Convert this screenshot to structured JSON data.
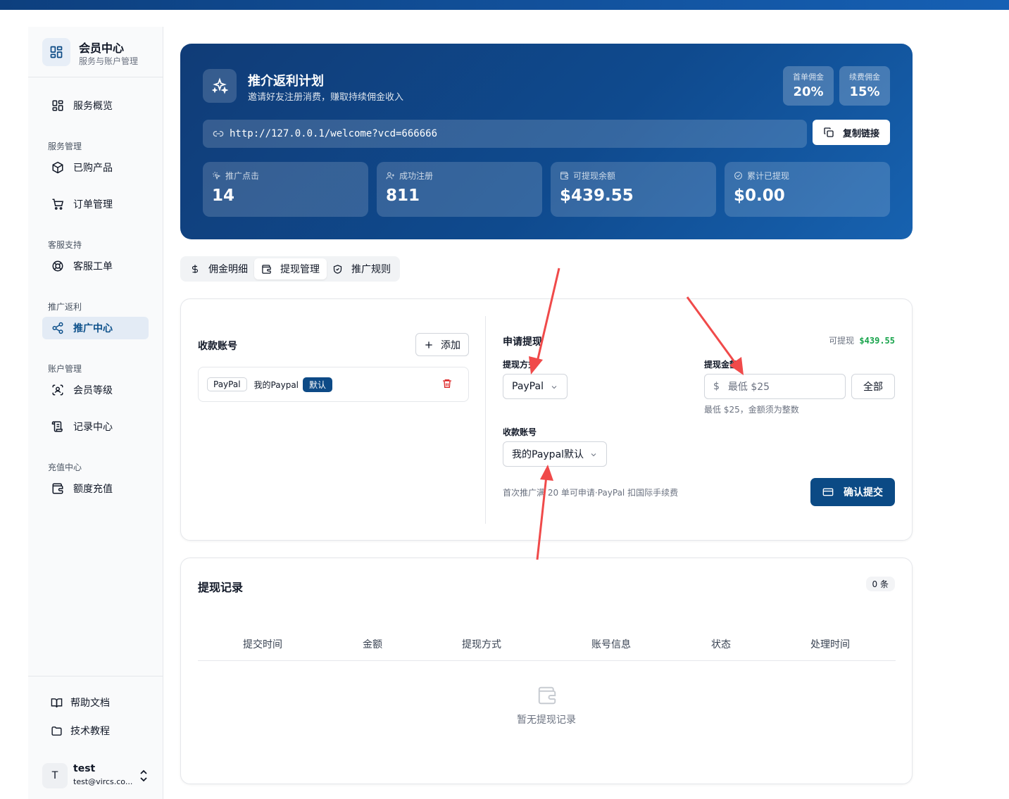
{
  "sidebar": {
    "brand_title": "会员中心",
    "brand_subtitle": "服务与账户管理",
    "overview": "服务概览",
    "groups": {
      "service": "服务管理",
      "support": "客服支持",
      "referral": "推广返利",
      "account": "账户管理",
      "recharge": "充值中心"
    },
    "items": {
      "purchased": "已购产品",
      "orders": "订单管理",
      "tickets": "客服工单",
      "referral_center": "推广中心",
      "member_level": "会员等级",
      "records": "记录中心",
      "quota_recharge": "额度充值"
    },
    "footer": {
      "help_docs": "帮助文档",
      "tutorials": "技术教程"
    },
    "user": {
      "avatar_letter": "T",
      "name": "test",
      "email": "test@vircs.co..."
    }
  },
  "hero": {
    "title": "推介返利计划",
    "subtitle": "邀请好友注册消费，赚取持续佣金收入",
    "first_commission_label": "首单佣金",
    "first_commission_value": "20%",
    "renew_commission_label": "续费佣金",
    "renew_commission_value": "15%",
    "referral_url": "http://127.0.0.1/welcome?vcd=666666",
    "copy_button": "复制链接",
    "stats": [
      {
        "label": "推广点击",
        "value": "14",
        "icon": "pointer-click-icon"
      },
      {
        "label": "成功注册",
        "value": "811",
        "icon": "user-plus-icon"
      },
      {
        "label": "可提现余额",
        "value": "$439.55",
        "icon": "wallet-icon"
      },
      {
        "label": "累计已提现",
        "value": "$0.00",
        "icon": "check-circle-icon"
      }
    ]
  },
  "tabs": {
    "commission": "佣金明细",
    "withdraw": "提现管理",
    "rules": "推广规则"
  },
  "withdraw_panel": {
    "accounts_title": "收款账号",
    "add_button": "添加",
    "account": {
      "type": "PayPal",
      "name": "我的Paypal",
      "default_badge": "默认"
    },
    "request_title": "申请提现",
    "available_label": "可提现",
    "available_value": "$439.55",
    "method_label": "提现方式",
    "method_value": "PayPal",
    "amount_label": "提现金额",
    "currency_symbol": "$",
    "amount_placeholder": "最低 $25",
    "all_button": "全部",
    "amount_hint": "最低 $25，金额须为整数",
    "account_label": "收款账号",
    "account_value": "我的Paypal默认",
    "note": "首次推广满 20 单可申请·PayPal 扣国际手续费",
    "submit_button": "确认提交"
  },
  "records": {
    "title": "提现记录",
    "count": "0 条",
    "columns": [
      "提交时间",
      "金额",
      "提现方式",
      "账号信息",
      "状态",
      "处理时间"
    ],
    "empty_text": "暂无提现记录"
  },
  "colors": {
    "brand_blue": "#0b4a85",
    "annotation_red": "#f04a4a",
    "available_green": "#16a34a",
    "delete_red": "#dc2626"
  }
}
